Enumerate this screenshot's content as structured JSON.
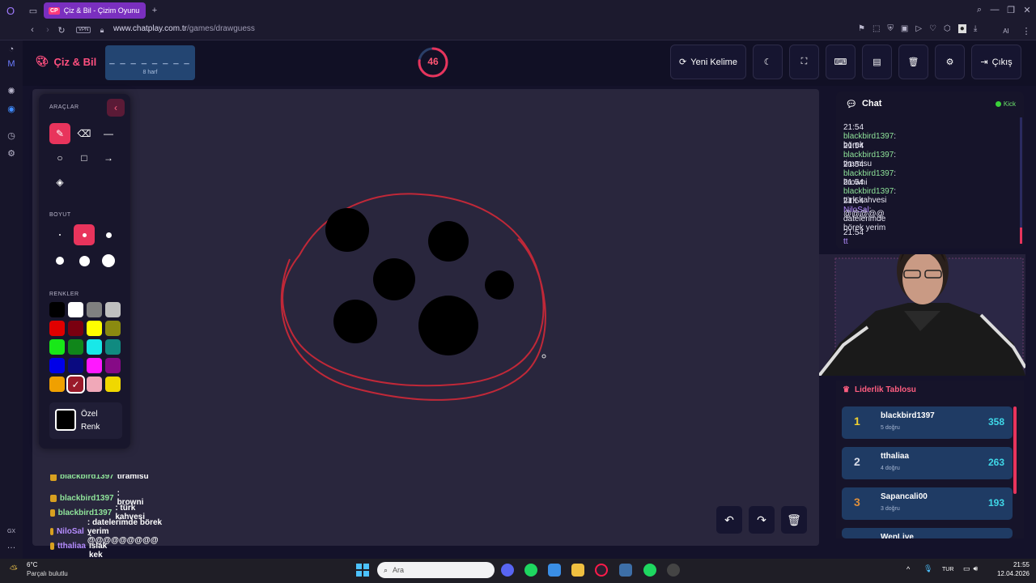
{
  "browser": {
    "tab_title": "Çiz & Bil - Çizim Oyunu",
    "tab_badge": "CP",
    "vpn_label": "VPN",
    "url_domain": "www.chatplay.com.tr",
    "url_path": "/games/drawguess",
    "ai_label": "AI"
  },
  "header": {
    "logo_text": "Çiz & Bil",
    "word_mask": "_ _ _ _ _ _ _ _",
    "word_hint": "8 harf",
    "timer": "46",
    "timer_fraction": 0.77,
    "new_word_label": "Yeni Kelime",
    "exit_label": "Çıkış"
  },
  "tools": {
    "title": "ARAÇLAR",
    "size_title": "BOYUT",
    "colors_title": "RENKLER",
    "custom_color_label_1": "Özel",
    "custom_color_label_2": "Renk",
    "palette": [
      "#000000",
      "#ffffff",
      "#808080",
      "#c0c0c0",
      "#e00000",
      "#7a0010",
      "#ffff00",
      "#8a8a10",
      "#18e818",
      "#10861a",
      "#18e8e8",
      "#108a80",
      "#0000e8",
      "#0a0a80",
      "#ff18ff",
      "#860a86",
      "#f0a000",
      "#9a1a2a",
      "#f0a8b8",
      "#f0d800"
    ],
    "selected_color": "#9a1a2a"
  },
  "bottom_chat": [
    {
      "user": "blackbird1397",
      "text": " : tiramisu"
    },
    {
      "user": "blackbird1397",
      "text": " : browni"
    },
    {
      "user": "blackbird1397",
      "text": " : türk kahvesi"
    },
    {
      "user": "NiloSal",
      "text": " : datelerimde börek yerim @@@@@@@@@"
    },
    {
      "user": "tthaliaa",
      "text": " : ıslak kek"
    }
  ],
  "chat": {
    "title": "Chat",
    "status": "Kick",
    "messages": [
      {
        "time": "21:54",
        "user": "blackbird1397",
        "text": ": börek"
      },
      {
        "time": "21:54",
        "user": "blackbird1397",
        "text": ": tiramisu"
      },
      {
        "time": "21:54",
        "user": "blackbird1397",
        "text": ": browni"
      },
      {
        "time": "21:54",
        "user": "blackbird1397",
        "text": ": türk kahvesi"
      },
      {
        "time": "21:54",
        "user": "NiloSal",
        "text": ": datelerimde börek yerim"
      },
      {
        "time": "",
        "user": "",
        "text": "@@@@@"
      },
      {
        "time": "21:54",
        "user": "tt",
        "text": ""
      }
    ]
  },
  "leaderboard": {
    "title": "Liderlik Tablosu",
    "rows": [
      {
        "rank": "1",
        "name": "blackbird1397",
        "correct": "5 doğru",
        "score": "358"
      },
      {
        "rank": "2",
        "name": "tthaliaa",
        "correct": "4 doğru",
        "score": "263"
      },
      {
        "rank": "3",
        "name": "Sapancali00",
        "correct": "3 doğru",
        "score": "193"
      },
      {
        "rank": "",
        "name": "WenLive",
        "correct": "",
        "score": ""
      }
    ]
  },
  "taskbar": {
    "weather_temp": "6°C",
    "weather_desc": "Parçalı bulutlu",
    "search_placeholder": "Ara",
    "lang": "TUR",
    "time": "21:55",
    "date": "12.04.2026"
  }
}
